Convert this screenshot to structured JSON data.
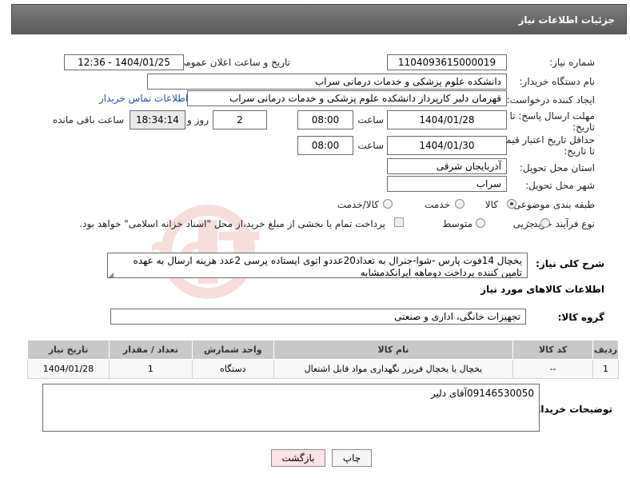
{
  "header": {
    "title": "جزئیات اطلاعات نیاز"
  },
  "fields": {
    "need_number_label": "شماره نیاز:",
    "need_number": "1104093615000019",
    "announce_label": "تاریخ و ساعت اعلان عمومی:",
    "announce_value": "1404/01/25 - 12:36",
    "buyer_org_label": "نام دستگاه خریدار:",
    "buyer_org": "دانشکده علوم پزشکی و خدمات درمانی سراب",
    "requester_label": "ایجاد کننده درخواست:",
    "requester": "قهرمان دلیر کارپرداز دانشکده علوم پزشکی و خدمات درمانی سراب",
    "contact_link": "اطلاعات تماس خریدار",
    "reply_deadline_label_1": "مهلت ارسال پاسخ: تا",
    "reply_deadline_label_2": "تاریخ:",
    "reply_date": "1404/01/28",
    "time_label": "ساعت",
    "reply_time": "08:00",
    "days_count": "2",
    "days_label": "روز و",
    "remaining_time": "18:34:14",
    "remaining_label": "ساعت باقی مانده",
    "price_validity_label_1": "حداقل تاریخ اعتبار قیمت:",
    "price_validity_label_2": "تا تاریخ:",
    "price_date": "1404/01/30",
    "price_time": "08:00",
    "province_label": "استان محل تحویل:",
    "province": "آذربایجان شرقی",
    "city_label": "شهر محل تحویل:",
    "city": "سراب",
    "category_label": "طبقه بندی موضوعی:",
    "category_options": [
      "کالا",
      "خدمت",
      "کالا/خدمت"
    ],
    "process_label": "نوع فرآیند خرید :",
    "process_options": [
      "جزیی",
      "متوسط"
    ],
    "payment_note": "پرداخت تمام یا بخشی از مبلغ خرید،از محل \"اسناد خزانه اسلامی\" خواهد بود."
  },
  "description": {
    "label": "شرح کلی نیاز:",
    "text": "یخچال 14فوت پارس -شوا-جنرال به تعداد20عددو اتوی ایستاده پرسی 2عدد هزینه ارسال به عهده تامین کننده پرداخت دوماهه ایرانکدمشابه"
  },
  "goods_info": {
    "title": "اطلاعات کالاهای مورد نیاز",
    "group_label": "گروه کالا:",
    "group_value": "تجهیزات خانگی، اداری و صنعتی",
    "columns": [
      "ردیف",
      "کد کالا",
      "نام کالا",
      "واحد شمارش",
      "تعداد / مقدار",
      "تاریخ نیاز"
    ],
    "rows": [
      [
        "1",
        "--",
        "یخچال یا یخچال فریزر نگهداری مواد قابل اشتعال",
        "دستگاه",
        "1",
        "1404/01/28"
      ]
    ]
  },
  "buyer_notes": {
    "label": "توضیحات خریدار:",
    "text": "09146530050آقای دلیر"
  },
  "buttons": {
    "print": "چاپ",
    "back": "بازگشت"
  },
  "watermark": {
    "text": "AriaTender.neT"
  },
  "colors": {
    "title_bar": "#6a6a6a",
    "link": "#1e4fa8",
    "back_button": "#fde3e6",
    "table_header": "#c8c8c8"
  }
}
